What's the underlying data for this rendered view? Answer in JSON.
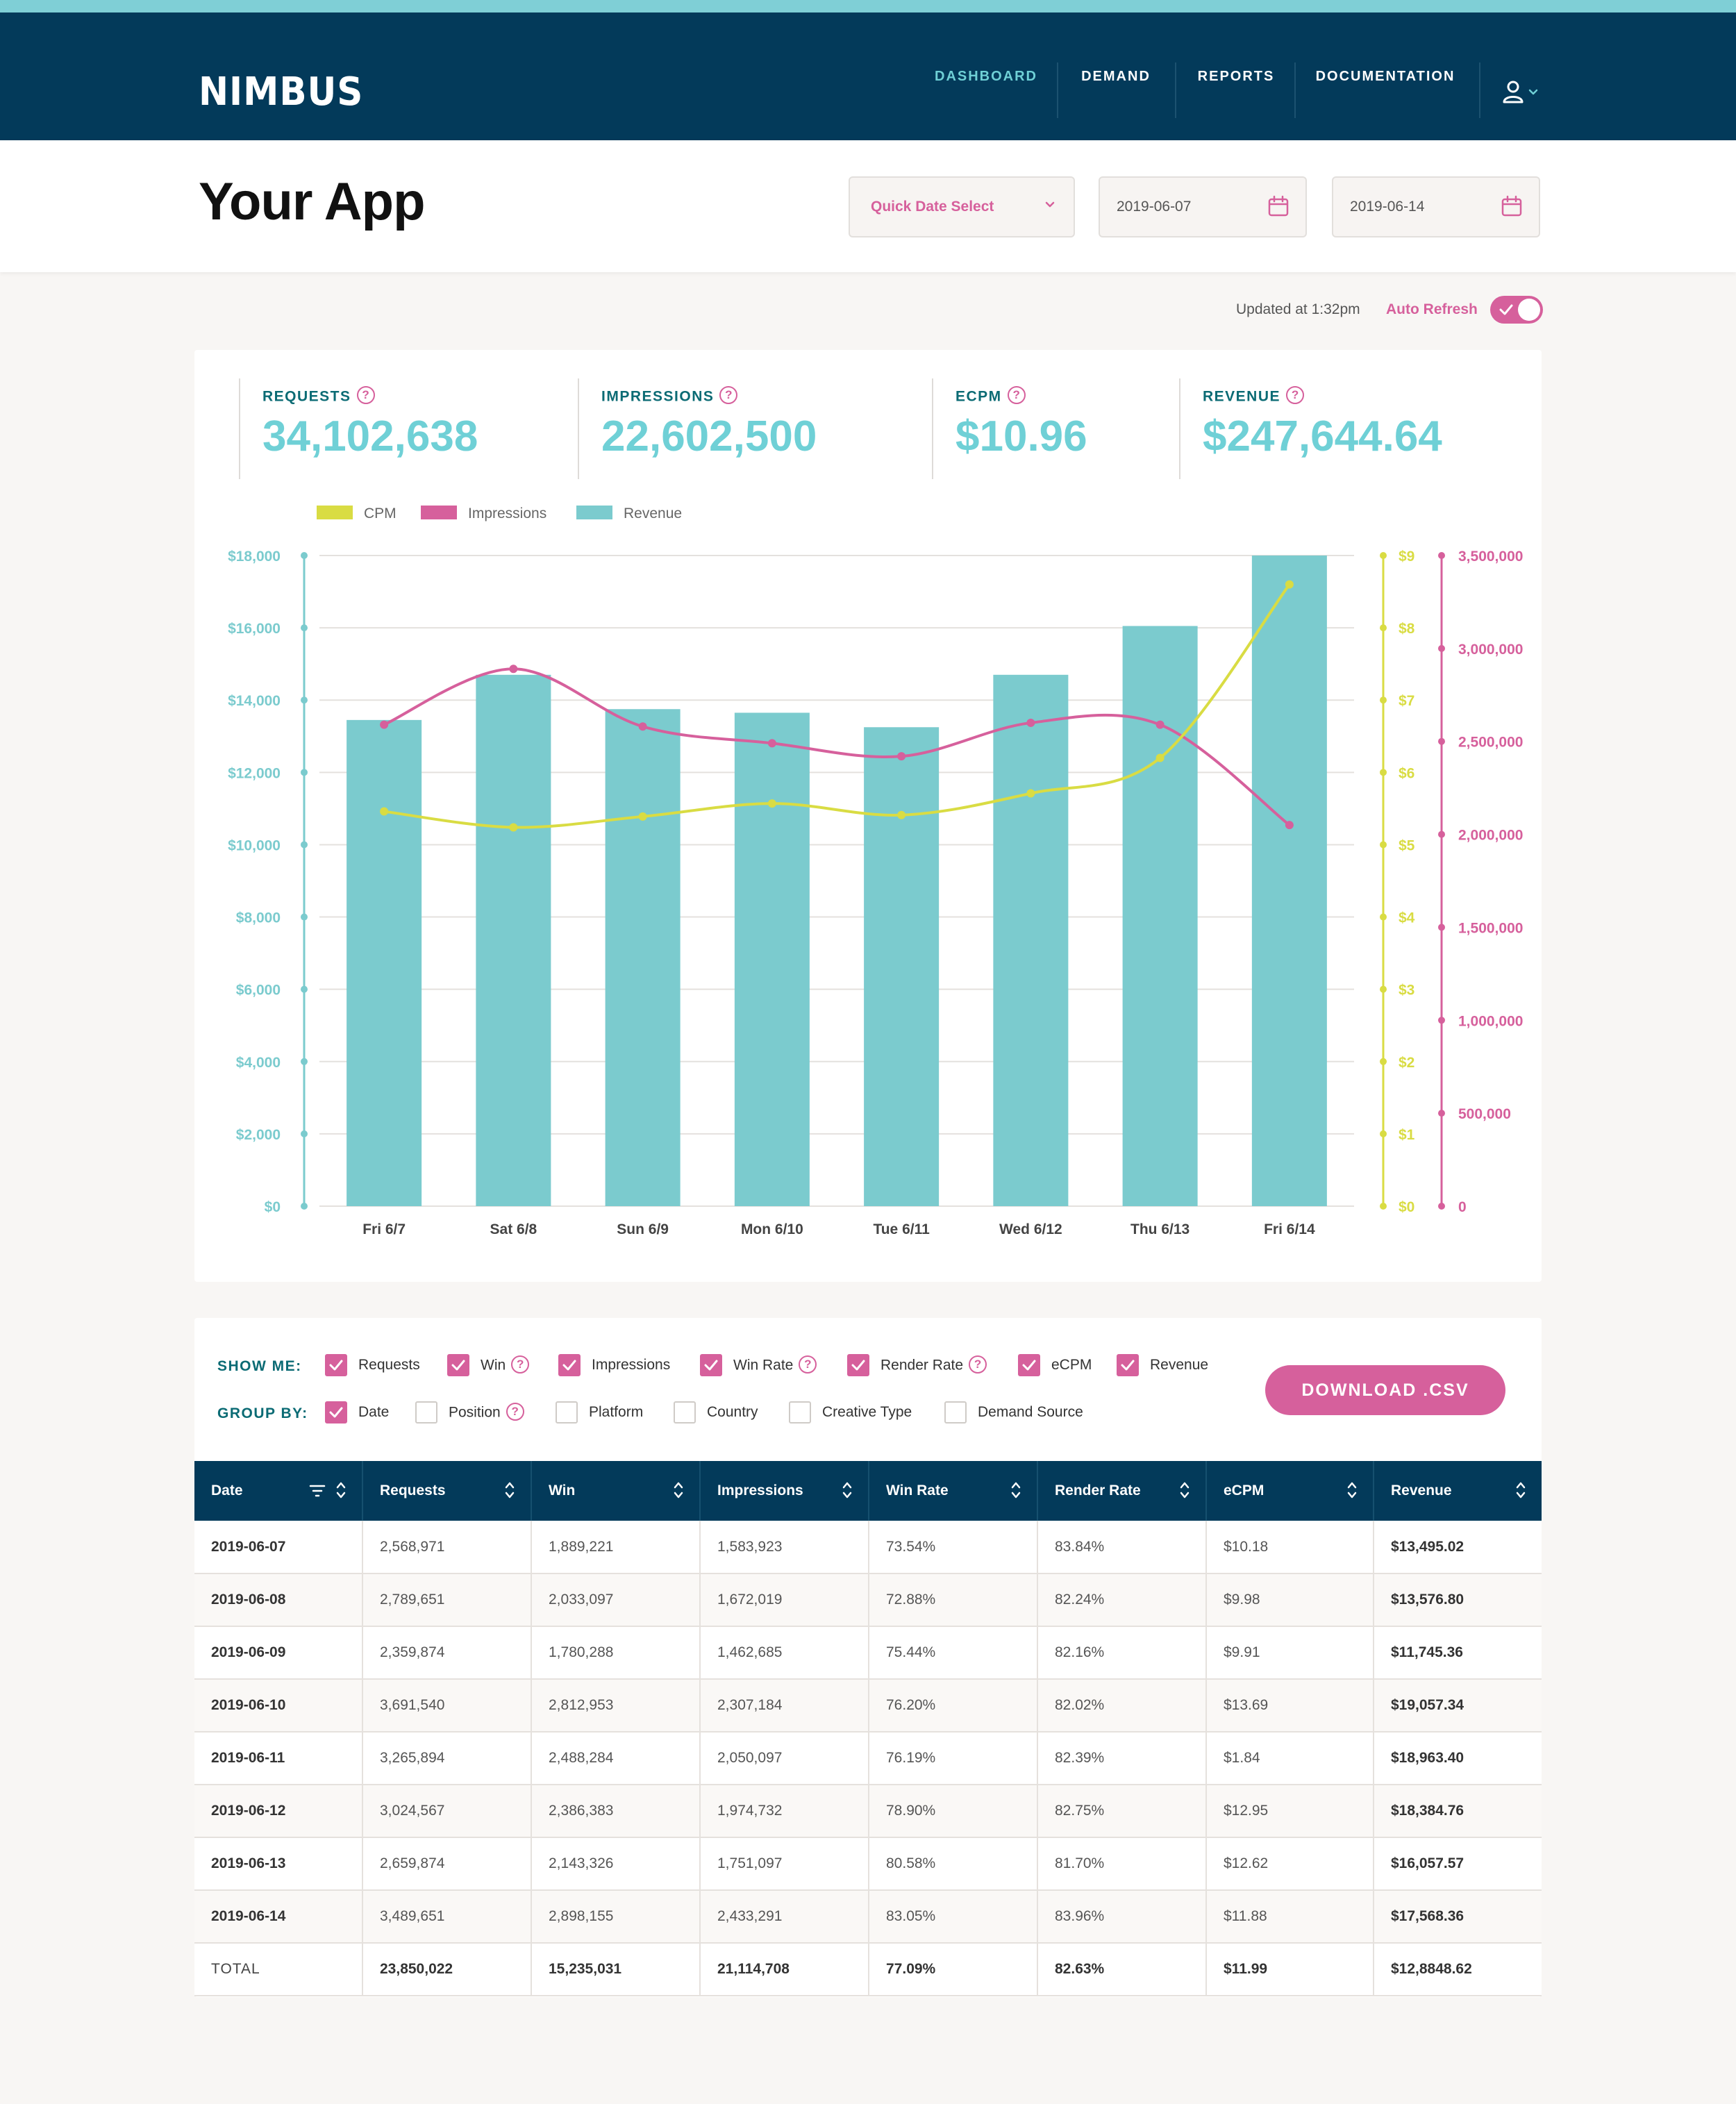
{
  "nav": {
    "logo": "NIMBUS",
    "items": [
      {
        "label": "DASHBOARD",
        "active": true
      },
      {
        "label": "DEMAND",
        "active": false
      },
      {
        "label": "REPORTS",
        "active": false
      },
      {
        "label": "DOCUMENTATION",
        "active": false
      }
    ],
    "user_icon": "user-icon"
  },
  "header": {
    "title": "Your App",
    "quick_date_select": "Quick Date Select",
    "start_date": "2019-06-07",
    "end_date": "2019-06-14"
  },
  "refresh": {
    "updated_text": "Updated at 1:32pm",
    "auto_refresh_label": "Auto Refresh",
    "auto_refresh_on": true
  },
  "metrics": [
    {
      "label": "REQUESTS",
      "value": "34,102,638"
    },
    {
      "label": "IMPRESSIONS",
      "value": "22,602,500"
    },
    {
      "label": "ECPM",
      "value": "$10.96"
    },
    {
      "label": "REVENUE",
      "value": "$247,644.64"
    }
  ],
  "colors": {
    "teal": "#7bcbce",
    "magenta": "#d6609c",
    "yellow": "#d9dc43",
    "navy": "#033a5a"
  },
  "chart_data": {
    "type": "bar",
    "categories": [
      "Fri 6/7",
      "Sat 6/8",
      "Sun 6/9",
      "Mon 6/10",
      "Tue 6/11",
      "Wed 6/12",
      "Thu 6/13",
      "Fri 6/14"
    ],
    "series": [
      {
        "name": "CPM",
        "type": "line",
        "axis": "cpm",
        "color": "#d9dc43",
        "values": [
          5.46,
          5.24,
          5.39,
          5.57,
          5.41,
          5.71,
          6.2,
          8.6
        ]
      },
      {
        "name": "Impressions",
        "type": "line",
        "axis": "impressions",
        "color": "#d6609c",
        "values": [
          2590000,
          2890000,
          2580000,
          2490000,
          2420000,
          2600000,
          2590000,
          2050000
        ]
      },
      {
        "name": "Revenue",
        "type": "bar",
        "axis": "revenue",
        "color": "#7bcbce",
        "values": [
          13450,
          14700,
          13750,
          13650,
          13250,
          14700,
          16050,
          18000
        ]
      }
    ],
    "axes": {
      "revenue": {
        "range": [
          0,
          18000
        ],
        "ticks": [
          "$0",
          "$2,000",
          "$4,000",
          "$6,000",
          "$8,000",
          "$10,000",
          "$12,000",
          "$14,000",
          "$16,000",
          "$18,000"
        ]
      },
      "cpm": {
        "range": [
          0,
          9
        ],
        "ticks": [
          "$0",
          "$1",
          "$2",
          "$3",
          "$4",
          "$5",
          "$6",
          "$7",
          "$8",
          "$9"
        ]
      },
      "impressions": {
        "range": [
          0,
          3500000
        ],
        "ticks": [
          "0",
          "500,000",
          "1,000,000",
          "1,500,000",
          "2,000,000",
          "2,500,000",
          "3,000,000",
          "3,500,000"
        ]
      }
    },
    "legend_position": "top-left",
    "grid": true
  },
  "options": {
    "show_me_label": "SHOW ME:",
    "group_by_label": "GROUP BY:",
    "show_me": [
      {
        "label": "Requests",
        "checked": true,
        "help": false
      },
      {
        "label": "Win",
        "checked": true,
        "help": true
      },
      {
        "label": "Impressions",
        "checked": true,
        "help": false
      },
      {
        "label": "Win Rate",
        "checked": true,
        "help": true
      },
      {
        "label": "Render Rate",
        "checked": true,
        "help": true
      },
      {
        "label": "eCPM",
        "checked": true,
        "help": false
      },
      {
        "label": "Revenue",
        "checked": true,
        "help": false
      }
    ],
    "group_by": [
      {
        "label": "Date",
        "checked": true,
        "help": false
      },
      {
        "label": "Position",
        "checked": false,
        "help": true
      },
      {
        "label": "Platform",
        "checked": false,
        "help": false
      },
      {
        "label": "Country",
        "checked": false,
        "help": false
      },
      {
        "label": "Creative Type",
        "checked": false,
        "help": false
      },
      {
        "label": "Demand Source",
        "checked": false,
        "help": false
      }
    ],
    "download_label": "DOWNLOAD .CSV",
    "help_glyph": "?"
  },
  "table": {
    "columns": [
      "Date",
      "Requests",
      "Win",
      "Impressions",
      "Win Rate",
      "Render Rate",
      "eCPM",
      "Revenue"
    ],
    "rows": [
      [
        "2019-06-07",
        "2,568,971",
        "1,889,221",
        "1,583,923",
        "73.54%",
        "83.84%",
        "$10.18",
        "$13,495.02"
      ],
      [
        "2019-06-08",
        "2,789,651",
        "2,033,097",
        "1,672,019",
        "72.88%",
        "82.24%",
        "$9.98",
        "$13,576.80"
      ],
      [
        "2019-06-09",
        "2,359,874",
        "1,780,288",
        "1,462,685",
        "75.44%",
        "82.16%",
        "$9.91",
        "$11,745.36"
      ],
      [
        "2019-06-10",
        "3,691,540",
        "2,812,953",
        "2,307,184",
        "76.20%",
        "82.02%",
        "$13.69",
        "$19,057.34"
      ],
      [
        "2019-06-11",
        "3,265,894",
        "2,488,284",
        "2,050,097",
        "76.19%",
        "82.39%",
        "$1.84",
        "$18,963.40"
      ],
      [
        "2019-06-12",
        "3,024,567",
        "2,386,383",
        "1,974,732",
        "78.90%",
        "82.75%",
        "$12.95",
        "$18,384.76"
      ],
      [
        "2019-06-13",
        "2,659,874",
        "2,143,326",
        "1,751,097",
        "80.58%",
        "81.70%",
        "$12.62",
        "$16,057.57"
      ],
      [
        "2019-06-14",
        "3,489,651",
        "2,898,155",
        "2,433,291",
        "83.05%",
        "83.96%",
        "$11.88",
        "$17,568.36"
      ]
    ],
    "total": [
      "TOTAL",
      "23,850,022",
      "15,235,031",
      "21,114,708",
      "77.09%",
      "82.63%",
      "$11.99",
      "$12,8848.62"
    ]
  }
}
